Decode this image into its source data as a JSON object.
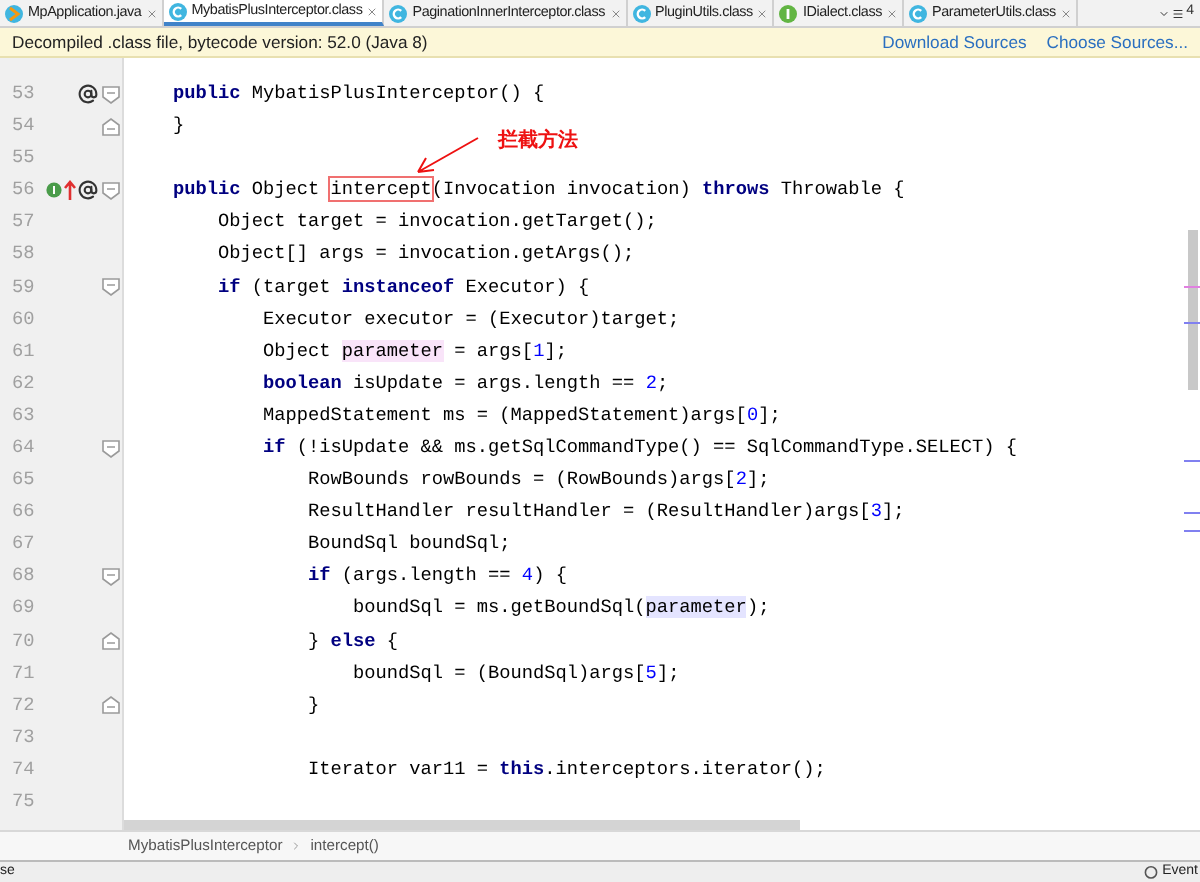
{
  "tabs": [
    {
      "label": "MpApplication.java",
      "kind": "java",
      "selected": false
    },
    {
      "label": "MybatisPlusInterceptor.class",
      "kind": "class",
      "selected": true
    },
    {
      "label": "PaginationInnerInterceptor.class",
      "kind": "class",
      "selected": false
    },
    {
      "label": "PluginUtils.class",
      "kind": "class",
      "selected": false
    },
    {
      "label": "IDialect.class",
      "kind": "interface",
      "selected": false
    },
    {
      "label": "ParameterUtils.class",
      "kind": "class",
      "selected": false
    }
  ],
  "overflow_count": "4",
  "info_bar": {
    "message": "Decompiled .class file, bytecode version: 52.0 (Java 8)",
    "links": [
      "Download Sources",
      "Choose Sources..."
    ]
  },
  "annotation": {
    "text": "拦截方法"
  },
  "lines": [
    {
      "number": "53",
      "marks": [
        {
          "kind": "annotation"
        }
      ],
      "fold": {
        "kind": "start"
      },
      "tokens": [
        {
          "kind": "keyword",
          "text": "    public"
        },
        {
          "kind": "text",
          "text": " MybatisPlusInterceptor() {"
        }
      ]
    },
    {
      "number": "54",
      "fold": {
        "kind": "end"
      },
      "tokens": [
        {
          "kind": "text",
          "text": "    }"
        }
      ]
    },
    {
      "number": "55"
    },
    {
      "number": "56",
      "marks": [
        {
          "kind": "implemented"
        },
        {
          "kind": "overrides"
        },
        {
          "kind": "annotation"
        }
      ],
      "fold": {
        "kind": "start"
      },
      "tokens": [
        {
          "kind": "keyword",
          "text": "    public"
        },
        {
          "kind": "text",
          "text": " Object "
        },
        {
          "kind": "boxed",
          "text": "intercept"
        },
        {
          "kind": "text",
          "text": "(Invocation invocation) "
        },
        {
          "kind": "keyword",
          "text": "throws"
        },
        {
          "kind": "text",
          "text": " Throwable {"
        }
      ]
    },
    {
      "number": "57",
      "tokens": [
        {
          "kind": "text",
          "text": "        Object target = invocation.getTarget();"
        }
      ]
    },
    {
      "number": "58",
      "tokens": [
        {
          "kind": "text",
          "text": "        Object[] args = invocation.getArgs();"
        }
      ]
    },
    {
      "number": "59",
      "fold": {
        "kind": "start"
      },
      "tokens": [
        {
          "kind": "keyword",
          "text": "        if"
        },
        {
          "kind": "text",
          "text": " (target "
        },
        {
          "kind": "keyword",
          "text": "instanceof"
        },
        {
          "kind": "text",
          "text": " Executor) {"
        }
      ]
    },
    {
      "number": "60",
      "tokens": [
        {
          "kind": "text",
          "text": "            Executor executor = (Executor)target;"
        }
      ]
    },
    {
      "number": "61",
      "tokens": [
        {
          "kind": "text",
          "text": "            Object "
        },
        {
          "kind": "param",
          "text": "parameter"
        },
        {
          "kind": "text",
          "text": " = args["
        },
        {
          "kind": "number",
          "text": "1"
        },
        {
          "kind": "text",
          "text": "];"
        }
      ]
    },
    {
      "number": "62",
      "tokens": [
        {
          "kind": "keyword",
          "text": "            boolean"
        },
        {
          "kind": "text",
          "text": " isUpdate = args.length == "
        },
        {
          "kind": "number",
          "text": "2"
        },
        {
          "kind": "text",
          "text": ";"
        }
      ]
    },
    {
      "number": "63",
      "tokens": [
        {
          "kind": "text",
          "text": "            MappedStatement ms = (MappedStatement)args["
        },
        {
          "kind": "number",
          "text": "0"
        },
        {
          "kind": "text",
          "text": "];"
        }
      ]
    },
    {
      "number": "64",
      "fold": {
        "kind": "start"
      },
      "tokens": [
        {
          "kind": "keyword",
          "text": "            if"
        },
        {
          "kind": "text",
          "text": " (!isUpdate && ms.getSqlCommandType() == SqlCommandType.SELECT) {"
        }
      ]
    },
    {
      "number": "65",
      "tokens": [
        {
          "kind": "text",
          "text": "                RowBounds rowBounds = (RowBounds)args["
        },
        {
          "kind": "number",
          "text": "2"
        },
        {
          "kind": "text",
          "text": "];"
        }
      ]
    },
    {
      "number": "66",
      "tokens": [
        {
          "kind": "text",
          "text": "                ResultHandler resultHandler = (ResultHandler)args["
        },
        {
          "kind": "number",
          "text": "3"
        },
        {
          "kind": "text",
          "text": "];"
        }
      ]
    },
    {
      "number": "67",
      "tokens": [
        {
          "kind": "text",
          "text": "                BoundSql boundSql;"
        }
      ]
    },
    {
      "number": "68",
      "fold": {
        "kind": "start"
      },
      "tokens": [
        {
          "kind": "keyword",
          "text": "                if"
        },
        {
          "kind": "text",
          "text": " (args.length == "
        },
        {
          "kind": "number",
          "text": "4"
        },
        {
          "kind": "text",
          "text": ") {"
        }
      ]
    },
    {
      "number": "69",
      "tokens": [
        {
          "kind": "text",
          "text": "                    boundSql = ms.getBoundSql("
        },
        {
          "kind": "usage",
          "text": "parameter"
        },
        {
          "kind": "text",
          "text": ");"
        }
      ]
    },
    {
      "number": "70",
      "fold": {
        "kind": "end"
      },
      "tokens": [
        {
          "kind": "text",
          "text": "                } "
        },
        {
          "kind": "keyword",
          "text": "else"
        },
        {
          "kind": "text",
          "text": " {"
        }
      ]
    },
    {
      "number": "71",
      "tokens": [
        {
          "kind": "text",
          "text": "                    boundSql = (BoundSql)args["
        },
        {
          "kind": "number",
          "text": "5"
        },
        {
          "kind": "text",
          "text": "];"
        }
      ]
    },
    {
      "number": "72",
      "fold": {
        "kind": "end"
      },
      "tokens": [
        {
          "kind": "text",
          "text": "                }"
        }
      ]
    },
    {
      "number": "73"
    },
    {
      "number": "74",
      "tokens": [
        {
          "kind": "text",
          "text": "                Iterator var11 = "
        },
        {
          "kind": "keyword",
          "text": "this"
        },
        {
          "kind": "text",
          "text": ".interceptors.iterator();"
        }
      ]
    },
    {
      "number": "75"
    }
  ],
  "breadcrumb": [
    "MybatisPlusInterceptor",
    "intercept()"
  ],
  "status_bar": {
    "left": "se",
    "right": "Event"
  }
}
